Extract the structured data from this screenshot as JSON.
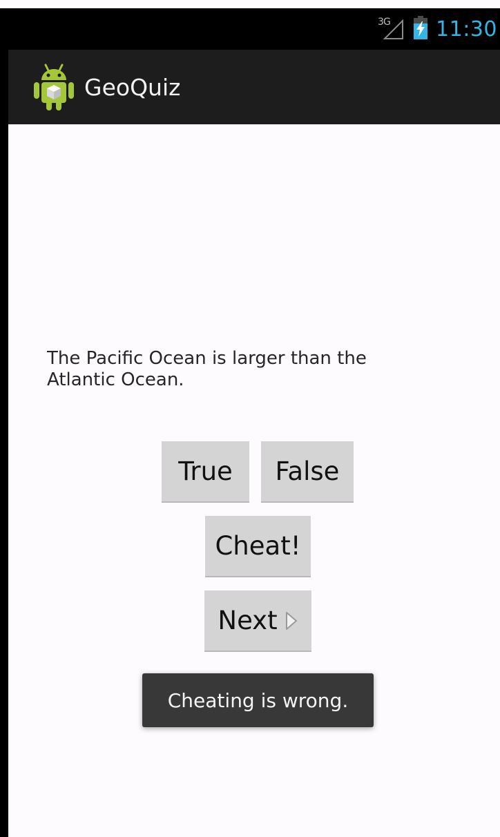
{
  "status_bar": {
    "network": "3G",
    "time": "11:30",
    "time_color": "#33b5e5",
    "icons": [
      "signal-icon",
      "battery-charging-icon"
    ]
  },
  "action_bar": {
    "title": "GeoQuiz",
    "icon": "android-launcher-icon"
  },
  "quiz": {
    "question": "The Pacific Ocean is larger than the Atlantic Ocean.",
    "true_label": "True",
    "false_label": "False",
    "cheat_label": "Cheat!",
    "next_label": "Next",
    "next_icon": "chevron-right-icon"
  },
  "toast": {
    "message": "Cheating is wrong."
  }
}
